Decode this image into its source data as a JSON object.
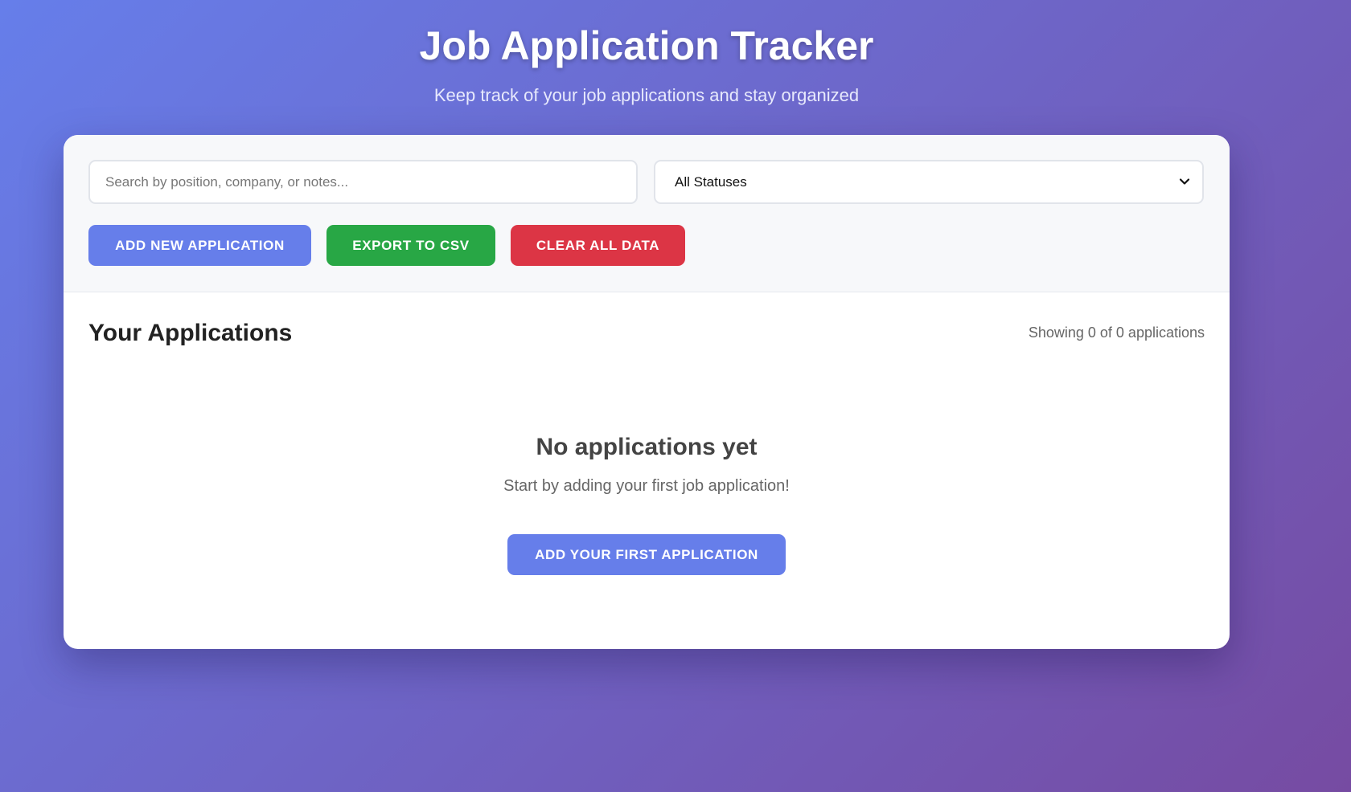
{
  "header": {
    "title": "Job Application Tracker",
    "subtitle": "Keep track of your job applications and stay organized"
  },
  "controls": {
    "search_placeholder": "Search by position, company, or notes...",
    "search_value": "",
    "status_filter": {
      "selected": "All Statuses",
      "icon": "chevron-down-icon"
    },
    "buttons": {
      "add_label": "ADD NEW APPLICATION",
      "export_label": "EXPORT TO CSV",
      "clear_label": "CLEAR ALL DATA"
    }
  },
  "applications": {
    "section_title": "Your Applications",
    "count_text": "Showing 0 of 0 applications",
    "items": []
  },
  "empty_state": {
    "title": "No applications yet",
    "text": "Start by adding your first job application!",
    "button_label": "ADD YOUR FIRST APPLICATION"
  },
  "colors": {
    "gradient_start": "#667eea",
    "gradient_end": "#764ba2",
    "primary": "#667eea",
    "success": "#28a745",
    "danger": "#dc3545"
  }
}
